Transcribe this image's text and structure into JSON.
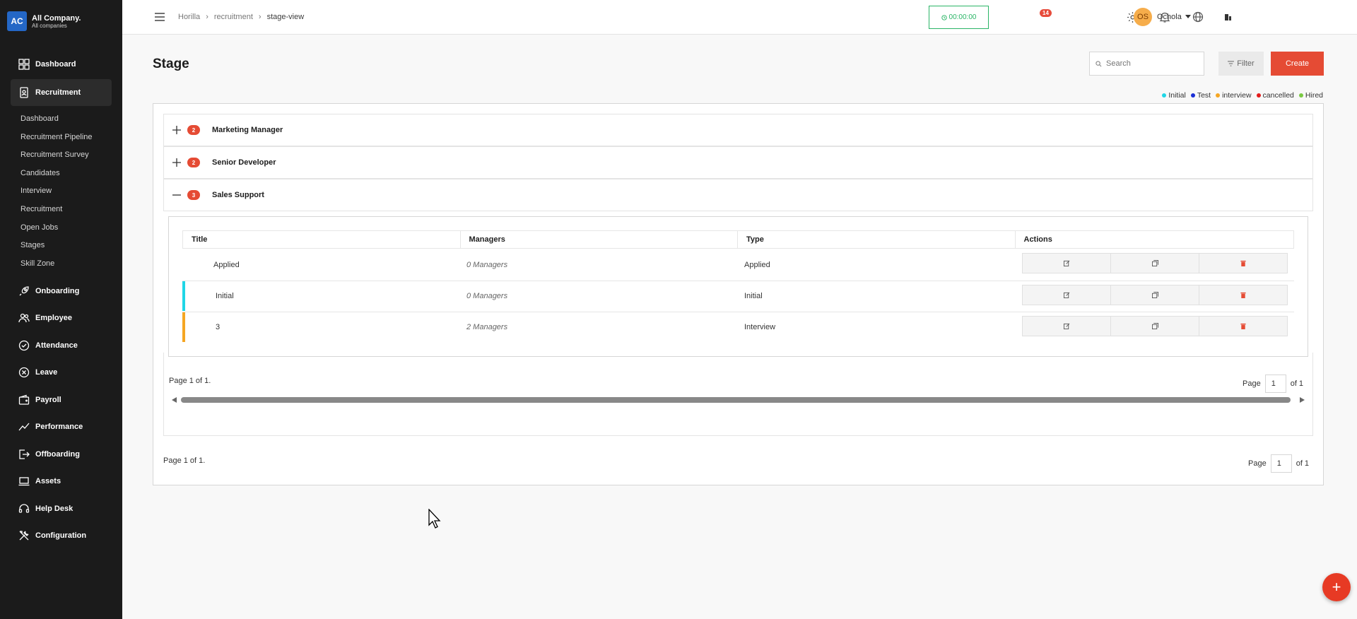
{
  "brand": {
    "logo_text": "AC",
    "name": "All Company.",
    "sub": "All companies"
  },
  "sidebar": {
    "top_items": [
      {
        "label": "Dashboard",
        "icon": "dashboard-icon"
      },
      {
        "label": "Recruitment",
        "icon": "recruitment-icon"
      }
    ],
    "recruitment_sub": [
      "Dashboard",
      "Recruitment Pipeline",
      "Recruitment Survey",
      "Candidates",
      "Interview",
      "Recruitment",
      "Open Jobs",
      "Stages",
      "Skill Zone"
    ],
    "items": [
      {
        "label": "Onboarding",
        "icon": "rocket-icon"
      },
      {
        "label": "Employee",
        "icon": "people-icon"
      },
      {
        "label": "Attendance",
        "icon": "check-circle-icon"
      },
      {
        "label": "Leave",
        "icon": "x-circle-icon"
      },
      {
        "label": "Payroll",
        "icon": "wallet-icon"
      },
      {
        "label": "Performance",
        "icon": "trend-icon"
      },
      {
        "label": "Offboarding",
        "icon": "exit-icon"
      },
      {
        "label": "Assets",
        "icon": "laptop-icon"
      },
      {
        "label": "Help Desk",
        "icon": "headset-icon"
      },
      {
        "label": "Configuration",
        "icon": "tools-icon"
      }
    ]
  },
  "header": {
    "breadcrumb": [
      "Horilla",
      "recruitment",
      "stage-view"
    ],
    "timer": "00:00:00",
    "notif_count": "14",
    "user_initials": "OS",
    "user_name": "Ochola"
  },
  "main": {
    "title": "Stage",
    "search_placeholder": "Search",
    "filter_label": "Filter",
    "create_label": "Create",
    "legend": [
      {
        "label": "Initial",
        "color": "#20d6e6"
      },
      {
        "label": "Test",
        "color": "#1b2fd6"
      },
      {
        "label": "interview",
        "color": "#f5a623"
      },
      {
        "label": "cancelled",
        "color": "#e31b1b"
      },
      {
        "label": "Hired",
        "color": "#7ac943"
      }
    ],
    "groups": [
      {
        "count": "2",
        "title": "Marketing Manager",
        "toggle": "+"
      },
      {
        "count": "2",
        "title": "Senior Developer",
        "toggle": "+"
      },
      {
        "count": "3",
        "title": "Sales Support",
        "toggle": "—"
      }
    ],
    "table": {
      "headers": [
        "Title",
        "Managers",
        "Type",
        "Actions"
      ],
      "rows": [
        {
          "title": "Applied",
          "managers": "0 Managers",
          "type": "Applied",
          "stripe": ""
        },
        {
          "title": "Initial",
          "managers": "0 Managers",
          "type": "Initial",
          "stripe": "#20d6e6"
        },
        {
          "title": "3",
          "managers": "2 Managers",
          "type": "Interview",
          "stripe": "#f5a623"
        }
      ]
    },
    "inner_pagination": {
      "text": "Page 1 of 1.",
      "page_label": "Page",
      "page_value": "1",
      "of_label": "of 1"
    },
    "outer_pagination": {
      "text": "Page 1 of 1.",
      "page_label": "Page",
      "page_value": "1",
      "of_label": "of 1"
    },
    "fab_label": "+"
  }
}
